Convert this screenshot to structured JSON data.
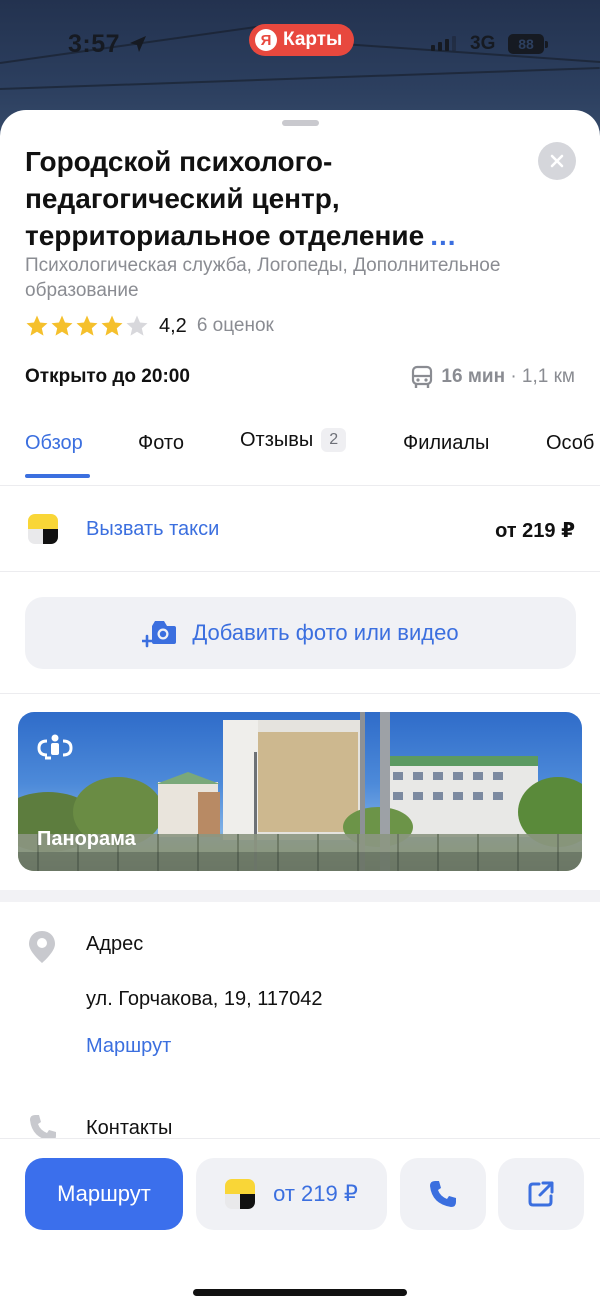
{
  "status_bar": {
    "time": "3:57",
    "app_pill": "Карты",
    "app_pill_logo": "Я",
    "network": "3G",
    "battery": "88"
  },
  "place": {
    "title": "Городской психолого-педагогический центр, территориальное отделение",
    "title_more": "...",
    "category": "Психологическая служба, Логопеды, Дополнительное образование",
    "rating": "4,2",
    "rating_stars": 4,
    "rating_count": "6 оценок",
    "hours": "Открыто до 20:00",
    "transit_time": "16 мин",
    "transit_distance": " · 1,1 км"
  },
  "tabs": [
    {
      "label": "Обзор",
      "active": true
    },
    {
      "label": "Фото"
    },
    {
      "label": "Отзывы",
      "badge": "2"
    },
    {
      "label": "Филиалы"
    },
    {
      "label": "Особ"
    }
  ],
  "taxi": {
    "label": "Вызвать такси",
    "price": "от 219 ₽"
  },
  "add_photo": {
    "label": "Добавить фото или видео"
  },
  "panorama": {
    "label": "Панорама"
  },
  "address": {
    "heading": "Адрес",
    "value": "ул. Горчакова, 19, 117042",
    "route_link": "Маршрут"
  },
  "contacts": {
    "heading": "Контакты"
  },
  "bottom_bar": {
    "route_label": "Маршрут",
    "taxi_price": "от 219 ₽"
  },
  "colors": {
    "accent": "#3b6fdf",
    "route_button": "#3b6fec",
    "star": "#f5c02c",
    "brand_red": "#e8483e"
  }
}
